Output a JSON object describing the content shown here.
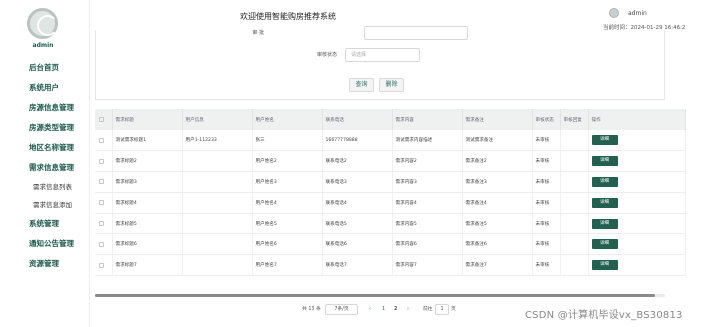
{
  "sidebar": {
    "user": "admin",
    "items": [
      {
        "label": "后台首页",
        "sub": false
      },
      {
        "label": "系统用户",
        "sub": false
      },
      {
        "label": "房源信息管理",
        "sub": false
      },
      {
        "label": "房源类型管理",
        "sub": false
      },
      {
        "label": "地区名称管理",
        "sub": false
      },
      {
        "label": "需求信息管理",
        "sub": false
      },
      {
        "label": "需求信息列表",
        "sub": true
      },
      {
        "label": "需求信息添加",
        "sub": true
      },
      {
        "label": "系统管理",
        "sub": false
      },
      {
        "label": "通知公告管理",
        "sub": false
      },
      {
        "label": "资源管理",
        "sub": false
      }
    ]
  },
  "header": {
    "title": "欢迎使用智能购房推荐系统",
    "user": "admin",
    "time": "当前时间：2024-01-29 16:46:2"
  },
  "search": {
    "field1_label": "审 批",
    "field1_value": "",
    "field2_label": "审核状态",
    "field2_placeholder": "请选择",
    "search_button": "查询",
    "delete_button": "删除"
  },
  "table": {
    "columns": [
      "",
      "需求标题",
      "用户信息",
      "用户姓名",
      "联系电话",
      "需求内容",
      "需求备注",
      "审核状态",
      "审核回复",
      "操作"
    ],
    "rows": [
      [
        "测试需求标题1",
        "用户1-112233",
        "张三",
        "16677778888",
        "测试需求内容描述",
        "测试需求备注",
        "未审核",
        "",
        "详细"
      ],
      [
        "需求标题2",
        "",
        "用户姓名2",
        "联系电话2",
        "需求内容2",
        "需求备注2",
        "未审核",
        "",
        "详细"
      ],
      [
        "需求标题3",
        "",
        "用户姓名3",
        "联系电话3",
        "需求内容3",
        "需求备注3",
        "未审核",
        "",
        "详细"
      ],
      [
        "需求标题4",
        "",
        "用户姓名4",
        "联系电话4",
        "需求内容4",
        "需求备注4",
        "未审核",
        "",
        "详细"
      ],
      [
        "需求标题5",
        "",
        "用户姓名5",
        "联系电话5",
        "需求内容5",
        "需求备注5",
        "未审核",
        "",
        "详细"
      ],
      [
        "需求标题6",
        "",
        "用户姓名6",
        "联系电话6",
        "需求内容6",
        "需求备注6",
        "未审核",
        "",
        "详细"
      ],
      [
        "需求标题7",
        "",
        "用户姓名7",
        "联系电话7",
        "需求内容7",
        "需求备注7",
        "未审核",
        "",
        "详细"
      ]
    ]
  },
  "pagination": {
    "total": "共 13 条",
    "page_size": "7条/页",
    "prev": "‹",
    "pages": [
      "1",
      "2"
    ],
    "next": "›",
    "goto_label": "前往",
    "goto_value": "1",
    "goto_suffix": "页"
  },
  "watermark": "CSDN @计算机毕设vx_BS30813",
  "colors": {
    "accent": "#24604f",
    "menu_text": "#1f5a4b",
    "table_header_bg": "#eef1f0"
  }
}
